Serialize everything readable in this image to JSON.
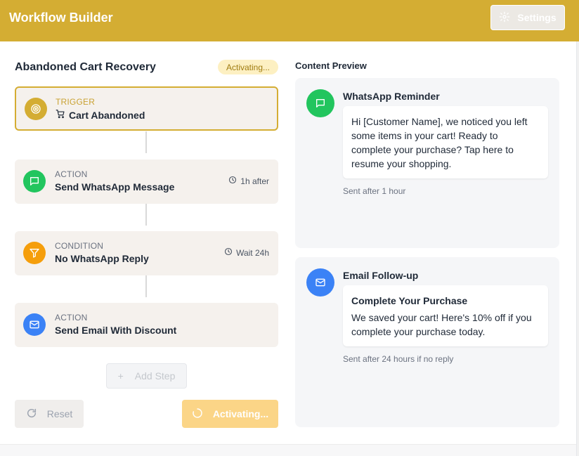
{
  "header": {
    "title": "Workflow Builder",
    "settings_label": "Settings",
    "settings_icon": "gear-icon"
  },
  "workflow": {
    "title": "Abandoned Cart Recovery",
    "status": "Activating...",
    "steps": [
      {
        "kind": "TRIGGER",
        "name": "Cart Abandoned",
        "icon": "target-icon",
        "name_icon": "cart-icon",
        "meta": "",
        "color": "#d4ad33"
      },
      {
        "kind": "ACTION",
        "name": "Send WhatsApp Message",
        "icon": "chat-bubble-icon",
        "meta": "1h after",
        "color": "#22c55e"
      },
      {
        "kind": "CONDITION",
        "name": "No WhatsApp Reply",
        "icon": "filter-icon",
        "meta": "Wait 24h",
        "color": "#f59e0b"
      },
      {
        "kind": "ACTION",
        "name": "Send Email With Discount",
        "icon": "mail-icon",
        "meta": "",
        "color": "#3b82f6"
      }
    ],
    "add_step_label": "Add Step",
    "add_step_icon": "+",
    "reset_label": "Reset",
    "activate_label": "Activating..."
  },
  "preview": {
    "title": "Content Preview",
    "whatsapp": {
      "title": "WhatsApp Reminder",
      "message_lines": [
        "Hi [Customer Name], we noticed you left",
        "some items in your cart! Ready to",
        "complete your purchase? Tap here to",
        "resume your shopping."
      ],
      "sent": "Sent after 1 hour",
      "color": "#22c55e"
    },
    "email": {
      "title": "Email Follow-up",
      "subject": "Complete Your Purchase",
      "body_lines": [
        "We saved your cart! Here's 10% off if you",
        "complete your purchase today."
      ],
      "sent": "Sent after 24 hours if no reply",
      "color": "#3b82f6"
    }
  }
}
